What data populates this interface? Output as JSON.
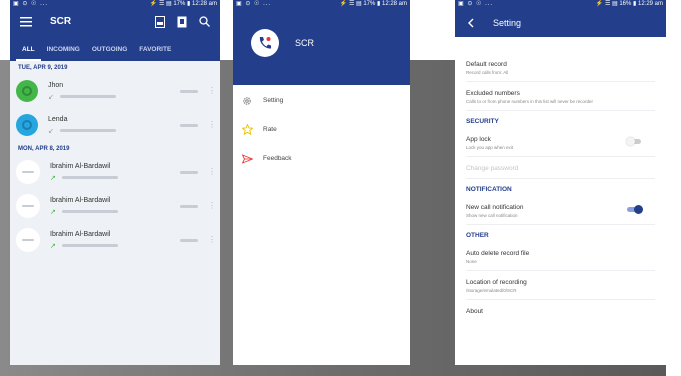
{
  "screen1": {
    "status_left": "▣ ⊙ ☉ ...",
    "status_right": "⚡ ☰ ▤ 17% ▮ 12:28 am",
    "title": "SCR",
    "tabs": [
      "ALL",
      "INCOMING",
      "OUTGOING",
      "FAVORITE"
    ],
    "groups": [
      {
        "date": "TUE, APR 9, 2019",
        "rows": [
          {
            "name": "Jhon",
            "avatar": "green"
          },
          {
            "name": "Lenda",
            "avatar": "blue"
          }
        ]
      },
      {
        "date": "MON, APR 8, 2019",
        "rows": [
          {
            "name": "Ibrahim Al-Bardawil",
            "avatar": "white"
          },
          {
            "name": "Ibrahim Al-Bardawil",
            "avatar": "white"
          },
          {
            "name": "Ibrahim Al-Bardawil",
            "avatar": "white"
          }
        ]
      }
    ]
  },
  "screen2": {
    "status_left": "▣ ⊙ ☉ ...",
    "status_right": "⚡ ☰ ▤ 17% ▮ 12:28 am",
    "drawer_title": "SCR",
    "menu": [
      {
        "label": "Setting",
        "icon": "gear-icon"
      },
      {
        "label": "Rate",
        "icon": "star-icon"
      },
      {
        "label": "Feedback",
        "icon": "send-icon"
      }
    ]
  },
  "screen3": {
    "status_left": "▣ ⊙ ☉ ...",
    "status_right": "⚡ ☰ ▤ 16% ▮ 12:29 am",
    "title": "Setting",
    "items": {
      "default_record": {
        "title": "Default record",
        "sub": "Record calls from: All"
      },
      "excluded": {
        "title": "Excluded numbers",
        "sub": "Calls to or from phone numbers in this list will never be recorder"
      },
      "security": "SECURITY",
      "app_lock": {
        "title": "App lock",
        "sub": "Lock you app when exit"
      },
      "change_password": {
        "title": "Change password"
      },
      "notification": "NOTIFICATION",
      "new_call": {
        "title": "New call notification",
        "sub": "Show new call notification"
      },
      "other": "OTHER",
      "auto_delete": {
        "title": "Auto delete record file",
        "sub": "None"
      },
      "location": {
        "title": "Location of recording",
        "sub": "/storage/emulated/0/SCR"
      },
      "about": {
        "title": "About"
      }
    }
  },
  "colors": {
    "primary": "#233e8b",
    "green": "#43b649",
    "blue": "#25a6e0",
    "toggle_on": "#233e8b"
  }
}
